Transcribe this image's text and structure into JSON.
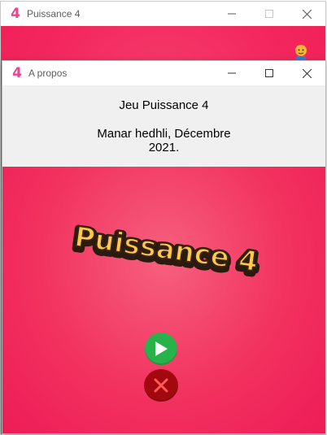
{
  "back_window": {
    "title": "Puissance 4",
    "icon": "four-logo-icon",
    "avatar": "player-avatar-icon"
  },
  "about_window": {
    "title": "A propos",
    "icon": "four-logo-icon",
    "line1": "Jeu Puissance 4",
    "line2": "Manar hedhli, Décembre 2021.",
    "logo_text": "Puissance 4",
    "play_icon": "play-icon",
    "quit_icon": "close-x-icon"
  },
  "controls": {
    "minimize": "minimize-icon",
    "maximize": "maximize-icon",
    "close": "close-icon"
  },
  "colors": {
    "pink": "#f2325f",
    "play_green": "#27b24a",
    "quit_red": "#a3080f",
    "logo_yellow": "#ffc94a",
    "app_icon": "#ef3f8e"
  }
}
